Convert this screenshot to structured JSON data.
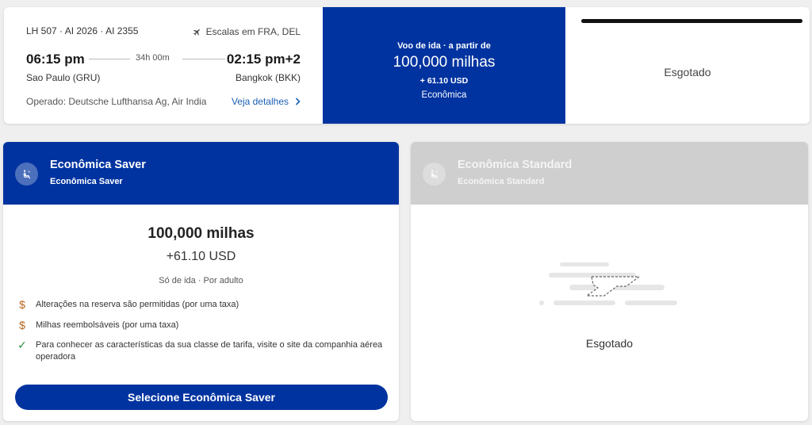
{
  "flight": {
    "numbers": "LH 507 · AI 2026 · AI 2355",
    "stops_icon": "plane-icon",
    "stops": "Escalas em FRA, DEL",
    "departure_time": "06:15 pm",
    "arrival_time": "02:15 pm+2",
    "duration": "34h 00m",
    "departure_city": "Sao Paulo (GRU)",
    "arrival_city": "Bangkok (BKK)",
    "operated_by": "Operado: Deutsche Lufthansa Ag, Air India",
    "details_link": "Veja detalhes",
    "details_icon": "chevron-right-icon"
  },
  "fare_summary": {
    "label": "Voo de ida · a partir de",
    "miles": "100,000 milhas",
    "usd": "+ 61.10 USD",
    "cabin": "Econômica"
  },
  "sold_out_summary": {
    "text": "Esgotado"
  },
  "saver_card": {
    "icon": "seat-icon",
    "title": "Econômica Saver",
    "subtitle": "Econômica Saver",
    "miles": "100,000 milhas",
    "usd": "+61.10 USD",
    "per_adult": "Só de ida · Por adulto",
    "features": [
      {
        "icon": "dollar-icon",
        "text": "Alterações na reserva são permitidas (por uma taxa)"
      },
      {
        "icon": "dollar-icon",
        "text": "Milhas reembolsáveis (por uma taxa)"
      },
      {
        "icon": "check-icon",
        "text": "Para conhecer as características da sua classe de tarifa, visite o site da companhia aérea operadora"
      }
    ],
    "button": "Selecione Econômica Saver"
  },
  "standard_card": {
    "icon": "seat-icon",
    "title": "Econômica Standard",
    "subtitle": "Econômica Standard",
    "illustration": "sold-out-plane-icon",
    "sold_out": "Esgotado"
  },
  "colors": {
    "brand_blue": "#0033a0",
    "disabled_gray": "#cfcfcf",
    "link_blue": "#1a5fb4",
    "dollar": "#b8651b",
    "check": "#2e8b3a"
  }
}
